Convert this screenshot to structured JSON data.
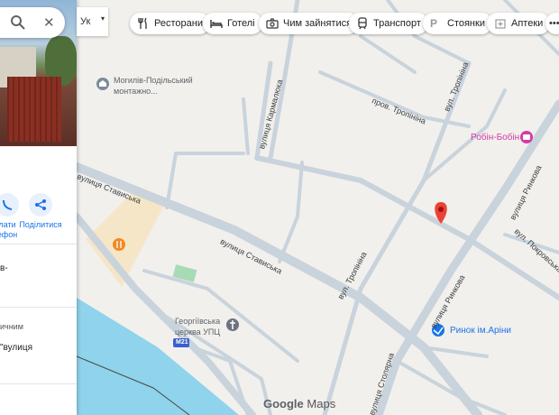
{
  "search": {
    "close_symbol": "✕"
  },
  "panel": {
    "actions": [
      {
        "label_line1": "лати",
        "label_line2": "ефон",
        "icon": "phone-icon"
      },
      {
        "label_line1": "Поділитися",
        "label_line2": "",
        "icon": "share-icon"
      }
    ],
    "fragments": [
      "в-",
      "ичним",
      "\"вулиця"
    ]
  },
  "language": {
    "value": "Ук"
  },
  "chips": [
    {
      "label": "Ресторани",
      "icon": "restaurant-icon"
    },
    {
      "label": "Готелі",
      "icon": "hotel-icon"
    },
    {
      "label": "Чим зайнятися",
      "icon": "camera-icon"
    },
    {
      "label": "Транспорт",
      "icon": "transit-icon"
    },
    {
      "label": "Стоянки",
      "icon": "parking-icon"
    },
    {
      "label": "Аптеки",
      "icon": "pharmacy-icon"
    }
  ],
  "map": {
    "places": {
      "mont_line1": "Могилів-Подільський",
      "mont_line2": "монтажно...",
      "robin": "Робін-Бобін",
      "church_line1": "Георгіївська",
      "church_line2": "церква УПЦ",
      "market": "Ринок ім.Аріни",
      "m21": "M21"
    },
    "streets": {
      "stavyska": "вулиця Стависька",
      "stavyska_left": "вулиця Стависька",
      "karmaliuka": "вулиця Кармалюка",
      "tropinina_prov": "пров. Тропініна",
      "tropinina1": "вул. Тропініна",
      "tropinina2": "вул. Тропініна",
      "rynkova1": "вулиця Ринкова",
      "rynkova2": "вулиця Ринкова",
      "pokrovska": "вул. Покровська",
      "stolyarna": "вулиця Столярна"
    },
    "colors": {
      "water": "#8fd3ec",
      "road": "#c9d3dc",
      "pin": "#ea4335",
      "robin": "#d63aa6",
      "market": "#1a73e8"
    }
  },
  "footer": {
    "brand": "Google",
    "product": "Maps"
  }
}
